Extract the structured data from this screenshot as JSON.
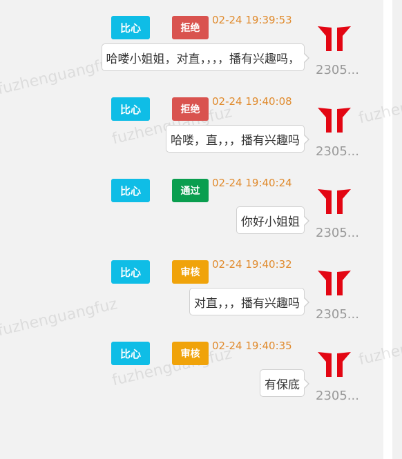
{
  "watermark": {
    "text": "fuzhenguangfuz"
  },
  "colors": {
    "user_tag": "#0fbde6",
    "reject": "#d9534f",
    "pass": "#0a9e4f",
    "review": "#f0a30a",
    "time": "#e08a2c",
    "avatar": "#e30613"
  },
  "messages": [
    {
      "user_tag": "比心",
      "status": "拒绝",
      "status_type": "reject",
      "time": "02-24 19:39:53",
      "text": "哈喽小姐姐，对直，，，，播有兴趣吗，",
      "uid": "2305...",
      "avatar_icon": "red-logo-icon"
    },
    {
      "user_tag": "比心",
      "status": "拒绝",
      "status_type": "reject",
      "time": "02-24 19:40:08",
      "text": "哈喽，直，，，播有兴趣吗",
      "uid": "2305...",
      "avatar_icon": "red-logo-icon"
    },
    {
      "user_tag": "比心",
      "status": "通过",
      "status_type": "pass",
      "time": "02-24 19:40:24",
      "text": "你好小姐姐",
      "uid": "2305...",
      "avatar_icon": "red-logo-icon"
    },
    {
      "user_tag": "比心",
      "status": "审核",
      "status_type": "review",
      "time": "02-24 19:40:32",
      "text": "对直，，，播有兴趣吗",
      "uid": "2305...",
      "avatar_icon": "red-logo-icon"
    },
    {
      "user_tag": "比心",
      "status": "审核",
      "status_type": "review",
      "time": "02-24 19:40:35",
      "text": "有保底",
      "uid": "2305...",
      "avatar_icon": "red-logo-icon"
    }
  ]
}
